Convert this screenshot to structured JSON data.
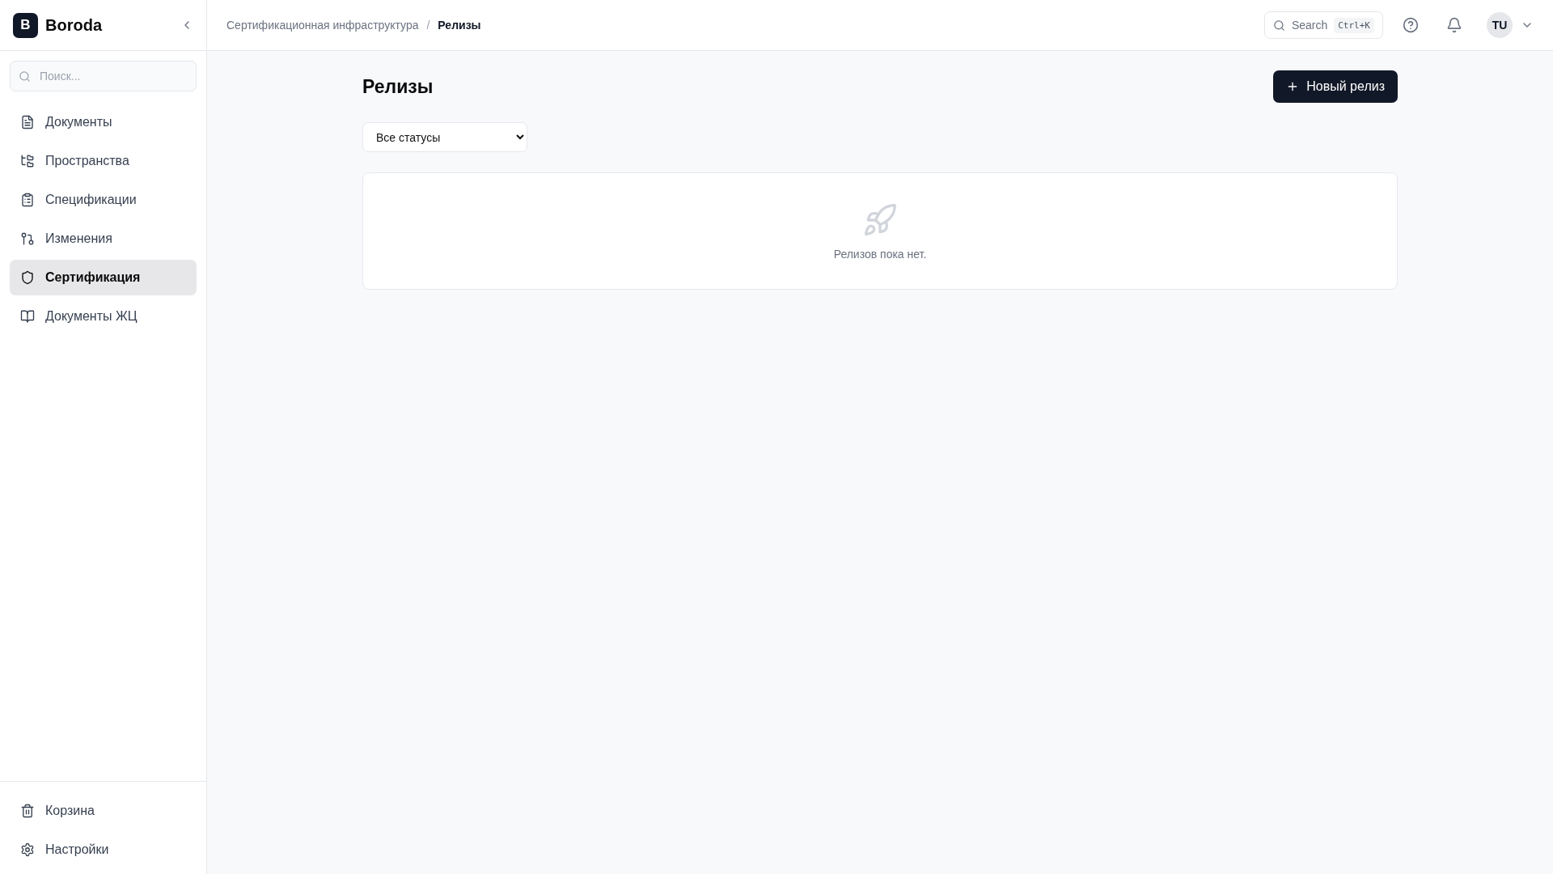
{
  "brand": {
    "logo_letter": "B",
    "name": "Boroda"
  },
  "sidebar": {
    "search": {
      "placeholder": "Поиск..."
    },
    "items": [
      {
        "label": "Документы",
        "selected": false
      },
      {
        "label": "Пространства",
        "selected": false
      },
      {
        "label": "Спецификации",
        "selected": false
      },
      {
        "label": "Изменения",
        "selected": false
      },
      {
        "label": "Сертификация",
        "selected": true
      },
      {
        "label": "Документы ЖЦ",
        "selected": false
      }
    ],
    "footer_items": [
      {
        "label": "Корзина"
      },
      {
        "label": "Настройки"
      }
    ]
  },
  "header": {
    "breadcrumbs": [
      "Сертификационная инфраструктура",
      "Релизы"
    ],
    "separator": "/",
    "search": {
      "label": "Search",
      "shortcut": "Ctrl+K"
    },
    "avatar": "TU"
  },
  "page": {
    "title": "Релизы",
    "new_button": "Новый релиз",
    "filter": {
      "value": "Все статусы"
    },
    "empty_text": "Релизов пока нет."
  }
}
